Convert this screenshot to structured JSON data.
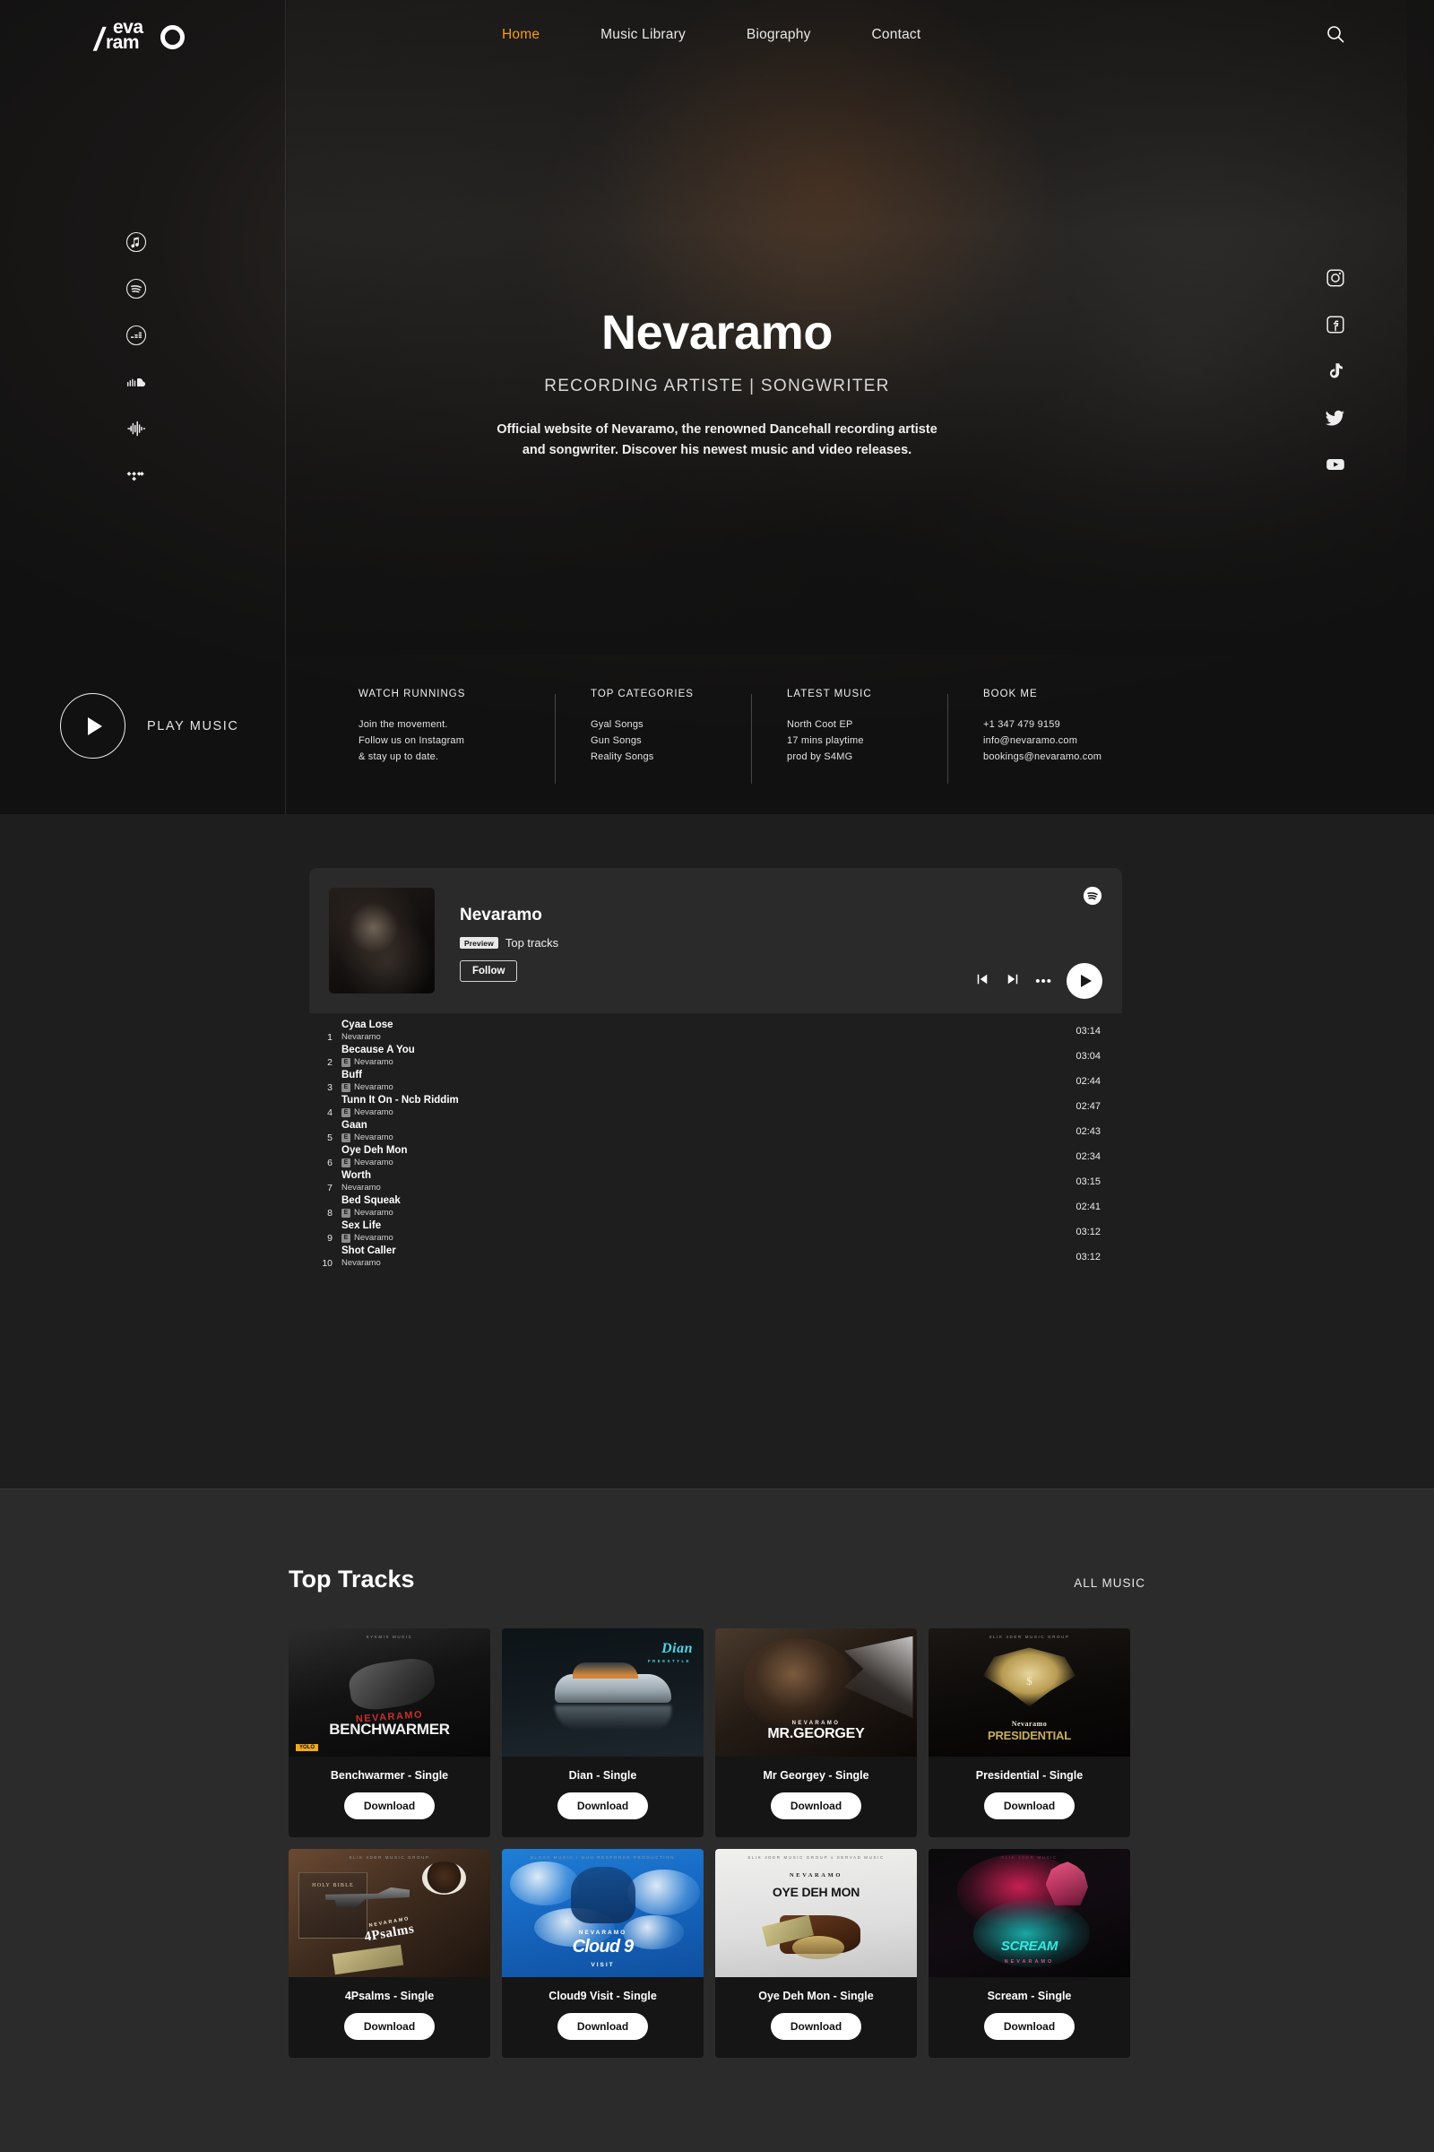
{
  "header": {
    "logo": {
      "line1": "eva",
      "line2": "ram",
      "name": "nevaramo-logo"
    },
    "nav": [
      {
        "label": "Home",
        "active": true
      },
      {
        "label": "Music Library",
        "active": false
      },
      {
        "label": "Biography",
        "active": false
      },
      {
        "label": "Contact",
        "active": false
      }
    ],
    "search_icon": "search-icon"
  },
  "rail_left": [
    {
      "icon": "apple-music-icon"
    },
    {
      "icon": "spotify-icon"
    },
    {
      "icon": "deezer-icon"
    },
    {
      "icon": "soundcloud-icon"
    },
    {
      "icon": "audiomack-icon"
    },
    {
      "icon": "tidal-icon"
    }
  ],
  "rail_right": [
    {
      "icon": "instagram-icon"
    },
    {
      "icon": "facebook-icon"
    },
    {
      "icon": "tiktok-icon"
    },
    {
      "icon": "twitter-icon"
    },
    {
      "icon": "youtube-icon"
    }
  ],
  "hero": {
    "title": "Nevaramo",
    "subtitle": "RECORDING ARTISTE | SONGWRITER",
    "description_line1": "Official website of Nevaramo, the renowned Dancehall recording artiste",
    "description_line2": "and songwriter. Discover his newest music and video releases."
  },
  "play_music": {
    "label": "PLAY MUSIC"
  },
  "info_columns": [
    {
      "heading": "WATCH RUNNINGS",
      "lines": [
        "Join the movement.",
        "Follow us on Instagram",
        "& stay up to date."
      ]
    },
    {
      "heading": "TOP CATEGORIES",
      "lines": [
        "Gyal Songs",
        "Gun Songs",
        "Reality Songs"
      ]
    },
    {
      "heading": "LATEST MUSIC",
      "lines": [
        "North Coot EP",
        "17 mins playtime",
        "prod by S4MG"
      ]
    },
    {
      "heading": "BOOK ME",
      "lines": [
        "+1 347 479 9159",
        "info@nevaramo.com",
        "bookings@nevaramo.com"
      ]
    }
  ],
  "spotify": {
    "artist": "Nevaramo",
    "preview_badge": "Preview",
    "playlist_label": "Top tracks",
    "follow_label": "Follow",
    "logo_icon": "spotify-icon",
    "prev_icon": "skip-previous-icon",
    "next_icon": "skip-next-icon",
    "more_icon": "more-options-icon",
    "play_icon": "play-icon",
    "tracks": [
      {
        "index": "1",
        "title": "Cyaa Lose",
        "artist": "Nevaramo",
        "explicit": false,
        "duration": "03:14"
      },
      {
        "index": "2",
        "title": "Because A You",
        "artist": "Nevaramo",
        "explicit": true,
        "duration": "03:04"
      },
      {
        "index": "3",
        "title": "Buff",
        "artist": "Nevaramo",
        "explicit": true,
        "duration": "02:44"
      },
      {
        "index": "4",
        "title": "Tunn It On - Ncb Riddim",
        "artist": "Nevaramo",
        "explicit": true,
        "duration": "02:47"
      },
      {
        "index": "5",
        "title": "Gaan",
        "artist": "Nevaramo",
        "explicit": true,
        "duration": "02:43"
      },
      {
        "index": "6",
        "title": "Oye Deh Mon",
        "artist": "Nevaramo",
        "explicit": true,
        "duration": "02:34"
      },
      {
        "index": "7",
        "title": "Worth",
        "artist": "Nevaramo",
        "explicit": false,
        "duration": "03:15"
      },
      {
        "index": "8",
        "title": "Bed Squeak",
        "artist": "Nevaramo",
        "explicit": true,
        "duration": "02:41"
      },
      {
        "index": "9",
        "title": "Sex Life",
        "artist": "Nevaramo",
        "explicit": true,
        "duration": "03:12"
      },
      {
        "index": "10",
        "title": "Shot Caller",
        "artist": "Nevaramo",
        "explicit": false,
        "duration": "03:12"
      }
    ]
  },
  "top_tracks": {
    "heading": "Top Tracks",
    "all_music_label": "ALL MUSIC",
    "download_label": "Download",
    "cards": [
      {
        "title": "Benchwarmer - Single",
        "art": {
          "label_top": "SYKMIX MUSIC",
          "artist": "NEVARAMO",
          "name": "BENCHWARMER",
          "badge": "YOLO"
        }
      },
      {
        "title": "Dian - Single",
        "art": {
          "name": "Dian",
          "sub": "FREESTYLE"
        }
      },
      {
        "title": "Mr Georgey - Single",
        "art": {
          "artist": "NEVARAMO",
          "name": "MR.GEORGEY"
        }
      },
      {
        "title": "Presidential - Single",
        "art": {
          "label_top": "SLIK 4DER MUSIC GROUP",
          "artist": "Nevaramo",
          "name": "PRESIDENTIAL",
          "symbol": "$"
        }
      },
      {
        "title": "4Psalms - Single",
        "art": {
          "label_top": "SLIK 4DER MUSIC GROUP",
          "book": "HOLY BIBLE",
          "artist": "NEVARAMO",
          "name": "4Psalms"
        }
      },
      {
        "title": "Cloud9 Visit - Single",
        "art": {
          "label_top": "BLOXX MUSIC / NUH RESPONSE PRODUCTION",
          "artist": "NEVARAMO",
          "name": "Cloud 9",
          "sub": "VISIT"
        }
      },
      {
        "title": "Oye Deh Mon - Single",
        "art": {
          "label_top": "SLIK 4DER MUSIC GROUP x SERVAD MUSIC",
          "artist": "NEVARAMO",
          "name": "OYE DEH MON"
        }
      },
      {
        "title": "Scream - Single",
        "art": {
          "label_top": "SLIK 4DER MUSIC",
          "name": "SCREAM",
          "artist": "NEVARAMO"
        }
      }
    ]
  },
  "colors": {
    "accent": "#f59b18",
    "hero_bg": "#111111",
    "spotify_bg": "#1e1e1e",
    "tracks_bg": "#2b2b2b",
    "card_bg": "#151515"
  }
}
